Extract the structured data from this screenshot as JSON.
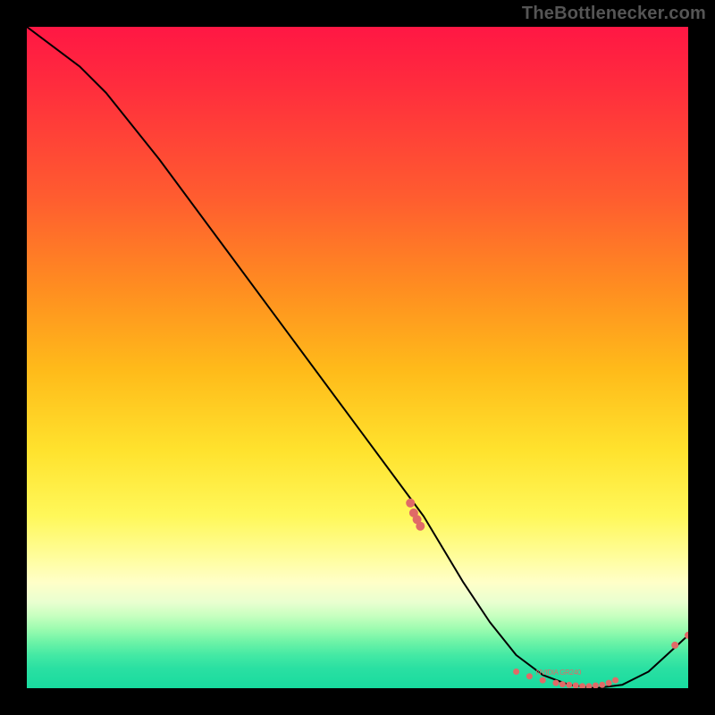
{
  "watermark": "TheBottlenecker.com",
  "chart_data": {
    "type": "line",
    "title": "",
    "xlabel": "",
    "ylabel": "",
    "xlim": [
      0,
      100
    ],
    "ylim": [
      0,
      100
    ],
    "x": [
      0,
      8,
      12,
      20,
      30,
      40,
      50,
      60,
      66,
      70,
      74,
      78,
      82,
      86,
      90,
      94,
      100
    ],
    "values": [
      100,
      94,
      90,
      80,
      66.5,
      53,
      39.5,
      26,
      16,
      10,
      5,
      2,
      0.5,
      0,
      0.5,
      2.5,
      8
    ],
    "points_cluster_left_x": [
      58,
      58.5,
      59,
      59.5
    ],
    "points_cluster_left_y": [
      28,
      26.5,
      25.5,
      24.5
    ],
    "points_flat_x": [
      74,
      76,
      78,
      80,
      81,
      82,
      83,
      84,
      85,
      86,
      87,
      88,
      89
    ],
    "points_flat_y": [
      2.5,
      1.8,
      1.2,
      0.8,
      0.6,
      0.5,
      0.4,
      0.3,
      0.3,
      0.4,
      0.5,
      0.8,
      1.2
    ],
    "points_right_end_x": [
      98,
      100
    ],
    "points_right_end_y": [
      6.5,
      8
    ],
    "inline_label": "NVIDIA GR240",
    "inline_label_x": 77,
    "inline_label_y": 1.5
  }
}
